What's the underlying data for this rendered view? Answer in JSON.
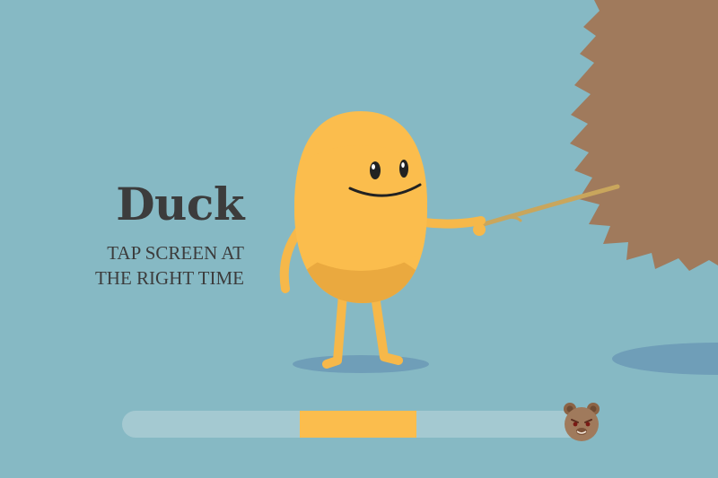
{
  "instruction": {
    "title": "Duck",
    "line1": "TAP SCREEN AT",
    "line2": "THE RIGHT TIME"
  },
  "timing_bar": {
    "target_zone_start": 0.38,
    "target_zone_end": 0.63,
    "marker_icon": "bear-face-icon"
  },
  "characters": {
    "bean": "yellow-bean-character",
    "bear": "brown-bear-character"
  },
  "colors": {
    "background": "#86b9c4",
    "bean": "#fbbd4d",
    "bean_shadow": "#eaa93f",
    "bear": "#a07a5c",
    "text": "#3c3c3c",
    "bar_track": "#a4c9d1",
    "bar_zone": "#fbbd4d"
  }
}
